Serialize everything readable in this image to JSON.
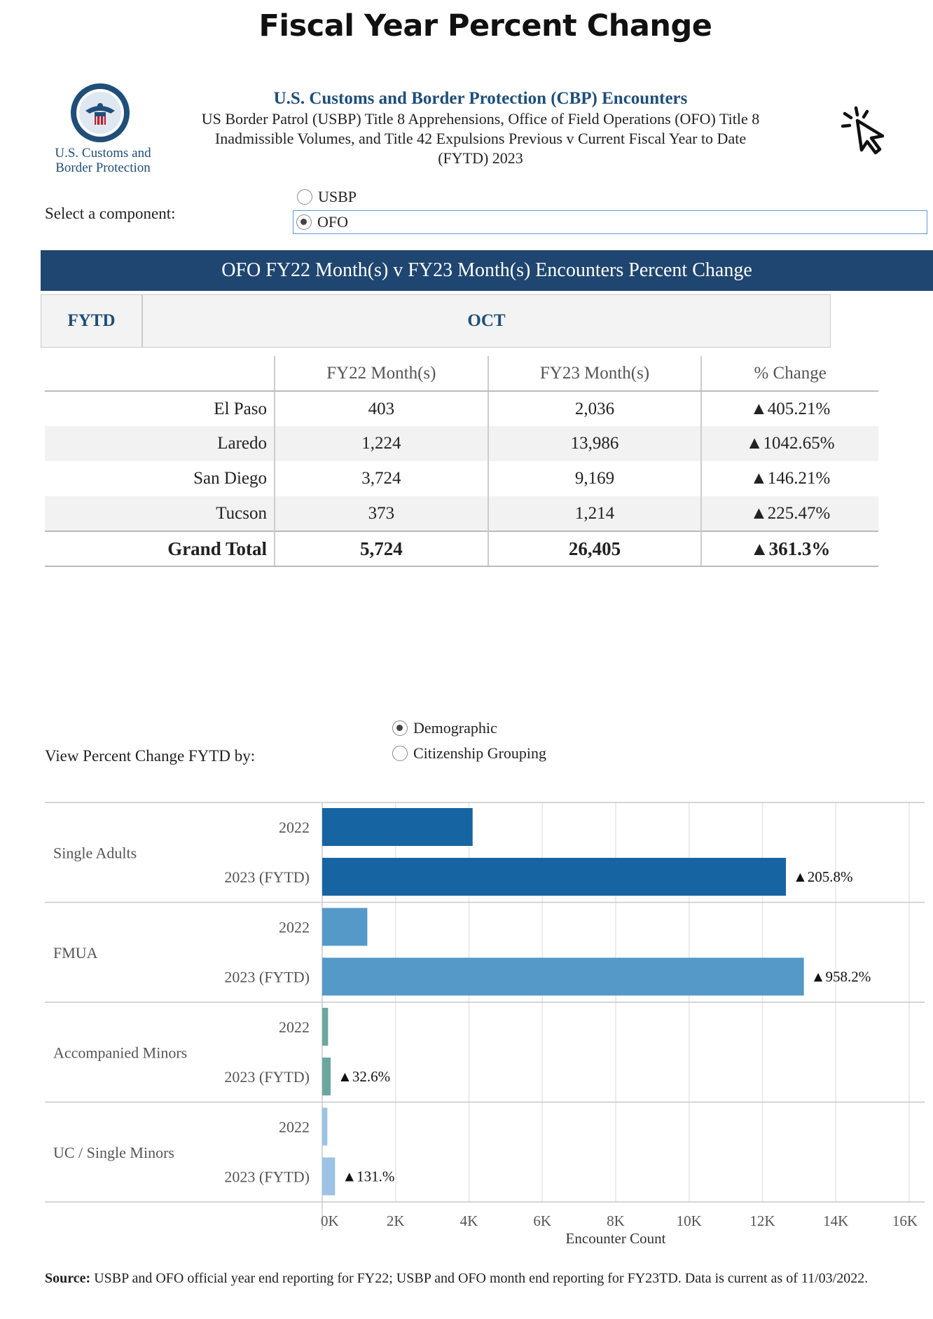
{
  "page_title": "Fiscal Year Percent Change",
  "logo": {
    "line1": "U.S. Customs and",
    "line2": "Border Protection"
  },
  "header": {
    "title": "U.S. Customs and Border Protection (CBP) Encounters",
    "subtitle_line1": "US Border Patrol (USBP) Title 8 Apprehensions, Office of Field Operations (OFO) Title 8",
    "subtitle_line2": "Inadmissible Volumes, and Title 42 Expulsions Previous v Current Fiscal Year to Date",
    "subtitle_line3": "(FYTD) 2023"
  },
  "component_selector": {
    "label": "Select a component:",
    "options": [
      {
        "label": "USBP",
        "selected": false
      },
      {
        "label": "OFO",
        "selected": true
      }
    ]
  },
  "banner": "OFO FY22 Month(s) v FY23 Month(s) Encounters Percent Change",
  "filters": {
    "fytd": "FYTD",
    "month": "OCT"
  },
  "table": {
    "headers": [
      "",
      "FY22 Month(s)",
      "FY23 Month(s)",
      "% Change"
    ],
    "rows": [
      {
        "name": "El Paso",
        "fy22": "403",
        "fy23": "2,036",
        "change": "▲405.21%"
      },
      {
        "name": "Laredo",
        "fy22": "1,224",
        "fy23": "13,986",
        "change": "▲1042.65%"
      },
      {
        "name": "San Diego",
        "fy22": "3,724",
        "fy23": "9,169",
        "change": "▲146.21%"
      },
      {
        "name": "Tucson",
        "fy22": "373",
        "fy23": "1,214",
        "change": "▲225.47%"
      }
    ],
    "total": {
      "name": "Grand Total",
      "fy22": "5,724",
      "fy23": "26,405",
      "change": "▲361.3%"
    }
  },
  "view_selector": {
    "label": "View Percent Change FYTD by:",
    "options": [
      {
        "label": "Demographic",
        "selected": true
      },
      {
        "label": "Citizenship Grouping",
        "selected": false
      }
    ]
  },
  "chart_data": {
    "type": "bar",
    "orientation": "horizontal",
    "xlabel": "Encounter Count",
    "xlim": [
      0,
      16000
    ],
    "ticks": [
      0,
      2000,
      4000,
      6000,
      8000,
      10000,
      12000,
      14000,
      16000
    ],
    "tick_labels": [
      "0K",
      "2K",
      "4K",
      "6K",
      "8K",
      "10K",
      "12K",
      "14K",
      "16K"
    ],
    "grid": true,
    "groups": [
      {
        "name": "Single Adults",
        "color": "#1764a3",
        "bars": [
          {
            "label": "2022",
            "value": 4100
          },
          {
            "label": "2023 (FYTD)",
            "value": 12640,
            "change": "▲205.8%"
          }
        ]
      },
      {
        "name": "FMUA",
        "color": "#5599c9",
        "bars": [
          {
            "label": "2022",
            "value": 1230
          },
          {
            "label": "2023 (FYTD)",
            "value": 13130,
            "change": "▲958.2%"
          }
        ]
      },
      {
        "name": "Accompanied Minors",
        "color": "#6aa89e",
        "bars": [
          {
            "label": "2022",
            "value": 160
          },
          {
            "label": "2023 (FYTD)",
            "value": 230,
            "change": "▲32.6%"
          }
        ]
      },
      {
        "name": "UC / Single Minors",
        "color": "#9cc3e4",
        "bars": [
          {
            "label": "2022",
            "value": 140
          },
          {
            "label": "2023 (FYTD)",
            "value": 350,
            "change": "▲131.%"
          }
        ]
      }
    ]
  },
  "source": {
    "label": "Source:",
    "text": "USBP and OFO official year end reporting for FY22; USBP and OFO month end reporting for FY23TD. Data is current as of 11/03/2022."
  }
}
